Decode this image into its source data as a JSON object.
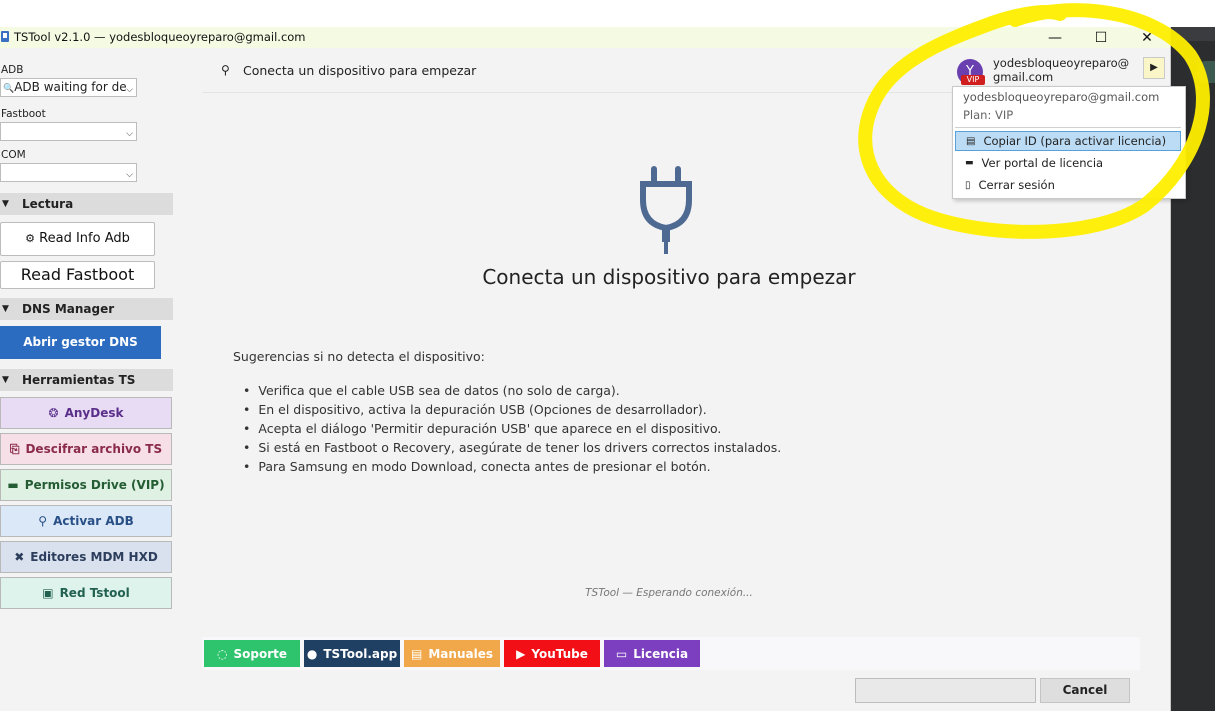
{
  "window": {
    "title": "TSTool v2.1.0 — yodesbloqueoyreparo@gmail.com",
    "controls": {
      "minimize": "—",
      "maximize": "☐",
      "close": "✕"
    }
  },
  "sidebar": {
    "adb_label": "ADB",
    "adb_value": "ADB waiting for de",
    "fastboot_label": "Fastboot",
    "fastboot_value": "",
    "com_label": "COM",
    "com_value": "",
    "sections": {
      "lectura": "Lectura",
      "dns": "DNS Manager",
      "herramientas": "Herramientas TS"
    },
    "read_info_adb": "Read Info Adb",
    "read_fastboot": "Read Fastboot",
    "open_dns": "Abrir gestor DNS",
    "tools": [
      {
        "label": "AnyDesk",
        "icon": "anydesk-icon"
      },
      {
        "label": "Descifrar archivo TS",
        "icon": "unlock-icon"
      },
      {
        "label": "Permisos Drive (VIP)",
        "icon": "drive-icon"
      },
      {
        "label": "Activar ADB",
        "icon": "plug-icon"
      },
      {
        "label": "Editores MDM HXD",
        "icon": "tools-icon"
      },
      {
        "label": "Red Tstool",
        "icon": "network-icon"
      }
    ]
  },
  "header": {
    "status": "Conecta un dispositivo para empezar",
    "user": {
      "avatar_letter": "Y",
      "badge": "VIP",
      "email_line1": "yodesbloqueoyreparo@",
      "email_line2": "gmail.com",
      "menu_toggle": "▶"
    }
  },
  "user_menu": {
    "email": "yodesbloqueoyreparo@gmail.com",
    "plan": "Plan: VIP",
    "items": [
      {
        "label": "Copiar ID (para activar licencia)",
        "icon": "copy-icon"
      },
      {
        "label": "Ver portal de licencia",
        "icon": "key-icon"
      },
      {
        "label": "Cerrar sesión",
        "icon": "logout-icon"
      }
    ]
  },
  "main": {
    "title": "Conecta un dispositivo para empezar",
    "tips_heading": "Sugerencias si no detecta el dispositivo:",
    "tips": [
      "Verifica que el cable USB sea de datos (no solo de carga).",
      "En el dispositivo, activa la depuración USB (Opciones de desarrollador).",
      "Acepta el diálogo 'Permitir depuración USB' que aparece en el dispositivo.",
      "Si está en Fastboot o Recovery, asegúrate de tener los drivers correctos instalados.",
      "Para Samsung en modo Download, conecta antes de presionar el botón."
    ],
    "footer_status": "TSTool — Esperando conexión..."
  },
  "links": [
    {
      "label": "Soporte",
      "color": "#2ec46e",
      "icon": "whatsapp-icon"
    },
    {
      "label": "TSTool.app",
      "color": "#1f3f63",
      "icon": "web-icon"
    },
    {
      "label": "Manuales",
      "color": "#f0a84a",
      "icon": "manual-icon"
    },
    {
      "label": "YouTube",
      "color": "#f20f15",
      "icon": "youtube-icon"
    },
    {
      "label": "Licencia",
      "color": "#7b3fc0",
      "icon": "license-icon"
    }
  ],
  "bottom": {
    "cancel": "Cancel",
    "progress_percent": 0
  },
  "colors": {
    "titlebar": "#f5fbe3",
    "dns_button": "#2b6cc0",
    "menu_highlight": "#bcdcf5",
    "annotation": "#ffee00"
  }
}
